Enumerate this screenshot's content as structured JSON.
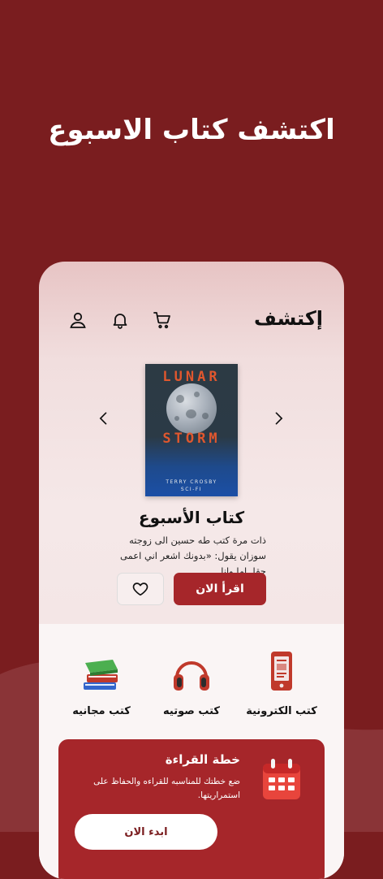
{
  "hero": {
    "title": "اكتشف كتاب الاسبوع"
  },
  "app": {
    "brand": "إكتشف",
    "icons": {
      "cart": "cart-icon",
      "bell": "bell-icon",
      "user": "user-icon"
    }
  },
  "book": {
    "cover": {
      "title_line1": "LUNAR",
      "title_line2": "STORM",
      "author": "TERRY CROSBY",
      "genre": "SCI-FI"
    },
    "section_title": "كتاب الأسبوع",
    "description": "ذات مرة كتب طه حسين الى زوجته سوزان يقول: «بدونك اشعر اني اعمى حقا. اما وانا",
    "read_button": "اقرأ الان"
  },
  "categories": [
    {
      "label": "كتب الكترونية",
      "icon": "ebook-icon"
    },
    {
      "label": "كتب صوتيه",
      "icon": "headphones-icon"
    },
    {
      "label": "كتب مجانيه",
      "icon": "books-stack-icon"
    }
  ],
  "plan": {
    "title": "خطة القراءة",
    "text": "ضع خطتك للمناسبه للقراءه والحفاظ على استمراريتها.",
    "button": "ابدء الان"
  },
  "colors": {
    "primary": "#a6262a",
    "background": "#7a1d1f",
    "card": "#f5e8e8"
  }
}
